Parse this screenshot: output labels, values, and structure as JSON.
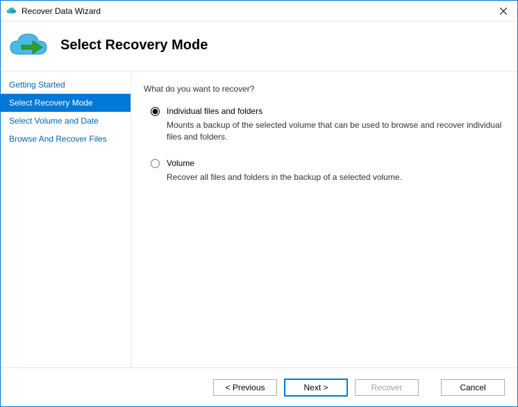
{
  "titlebar": {
    "title": "Recover Data Wizard"
  },
  "header": {
    "title": "Select Recovery Mode"
  },
  "sidebar": {
    "items": [
      {
        "label": "Getting Started",
        "active": false
      },
      {
        "label": "Select Recovery Mode",
        "active": true
      },
      {
        "label": "Select Volume and Date",
        "active": false
      },
      {
        "label": "Browse And Recover Files",
        "active": false
      }
    ]
  },
  "main": {
    "question": "What do you want to recover?",
    "options": [
      {
        "id": "individual",
        "label": "Individual files and folders",
        "description": "Mounts a backup of the selected volume that can be used to browse and recover individual files and folders.",
        "selected": true
      },
      {
        "id": "volume",
        "label": "Volume",
        "description": "Recover all files and folders in the backup of a selected volume.",
        "selected": false
      }
    ]
  },
  "footer": {
    "previous": "< Previous",
    "next": "Next >",
    "recover": "Recover",
    "cancel": "Cancel"
  }
}
